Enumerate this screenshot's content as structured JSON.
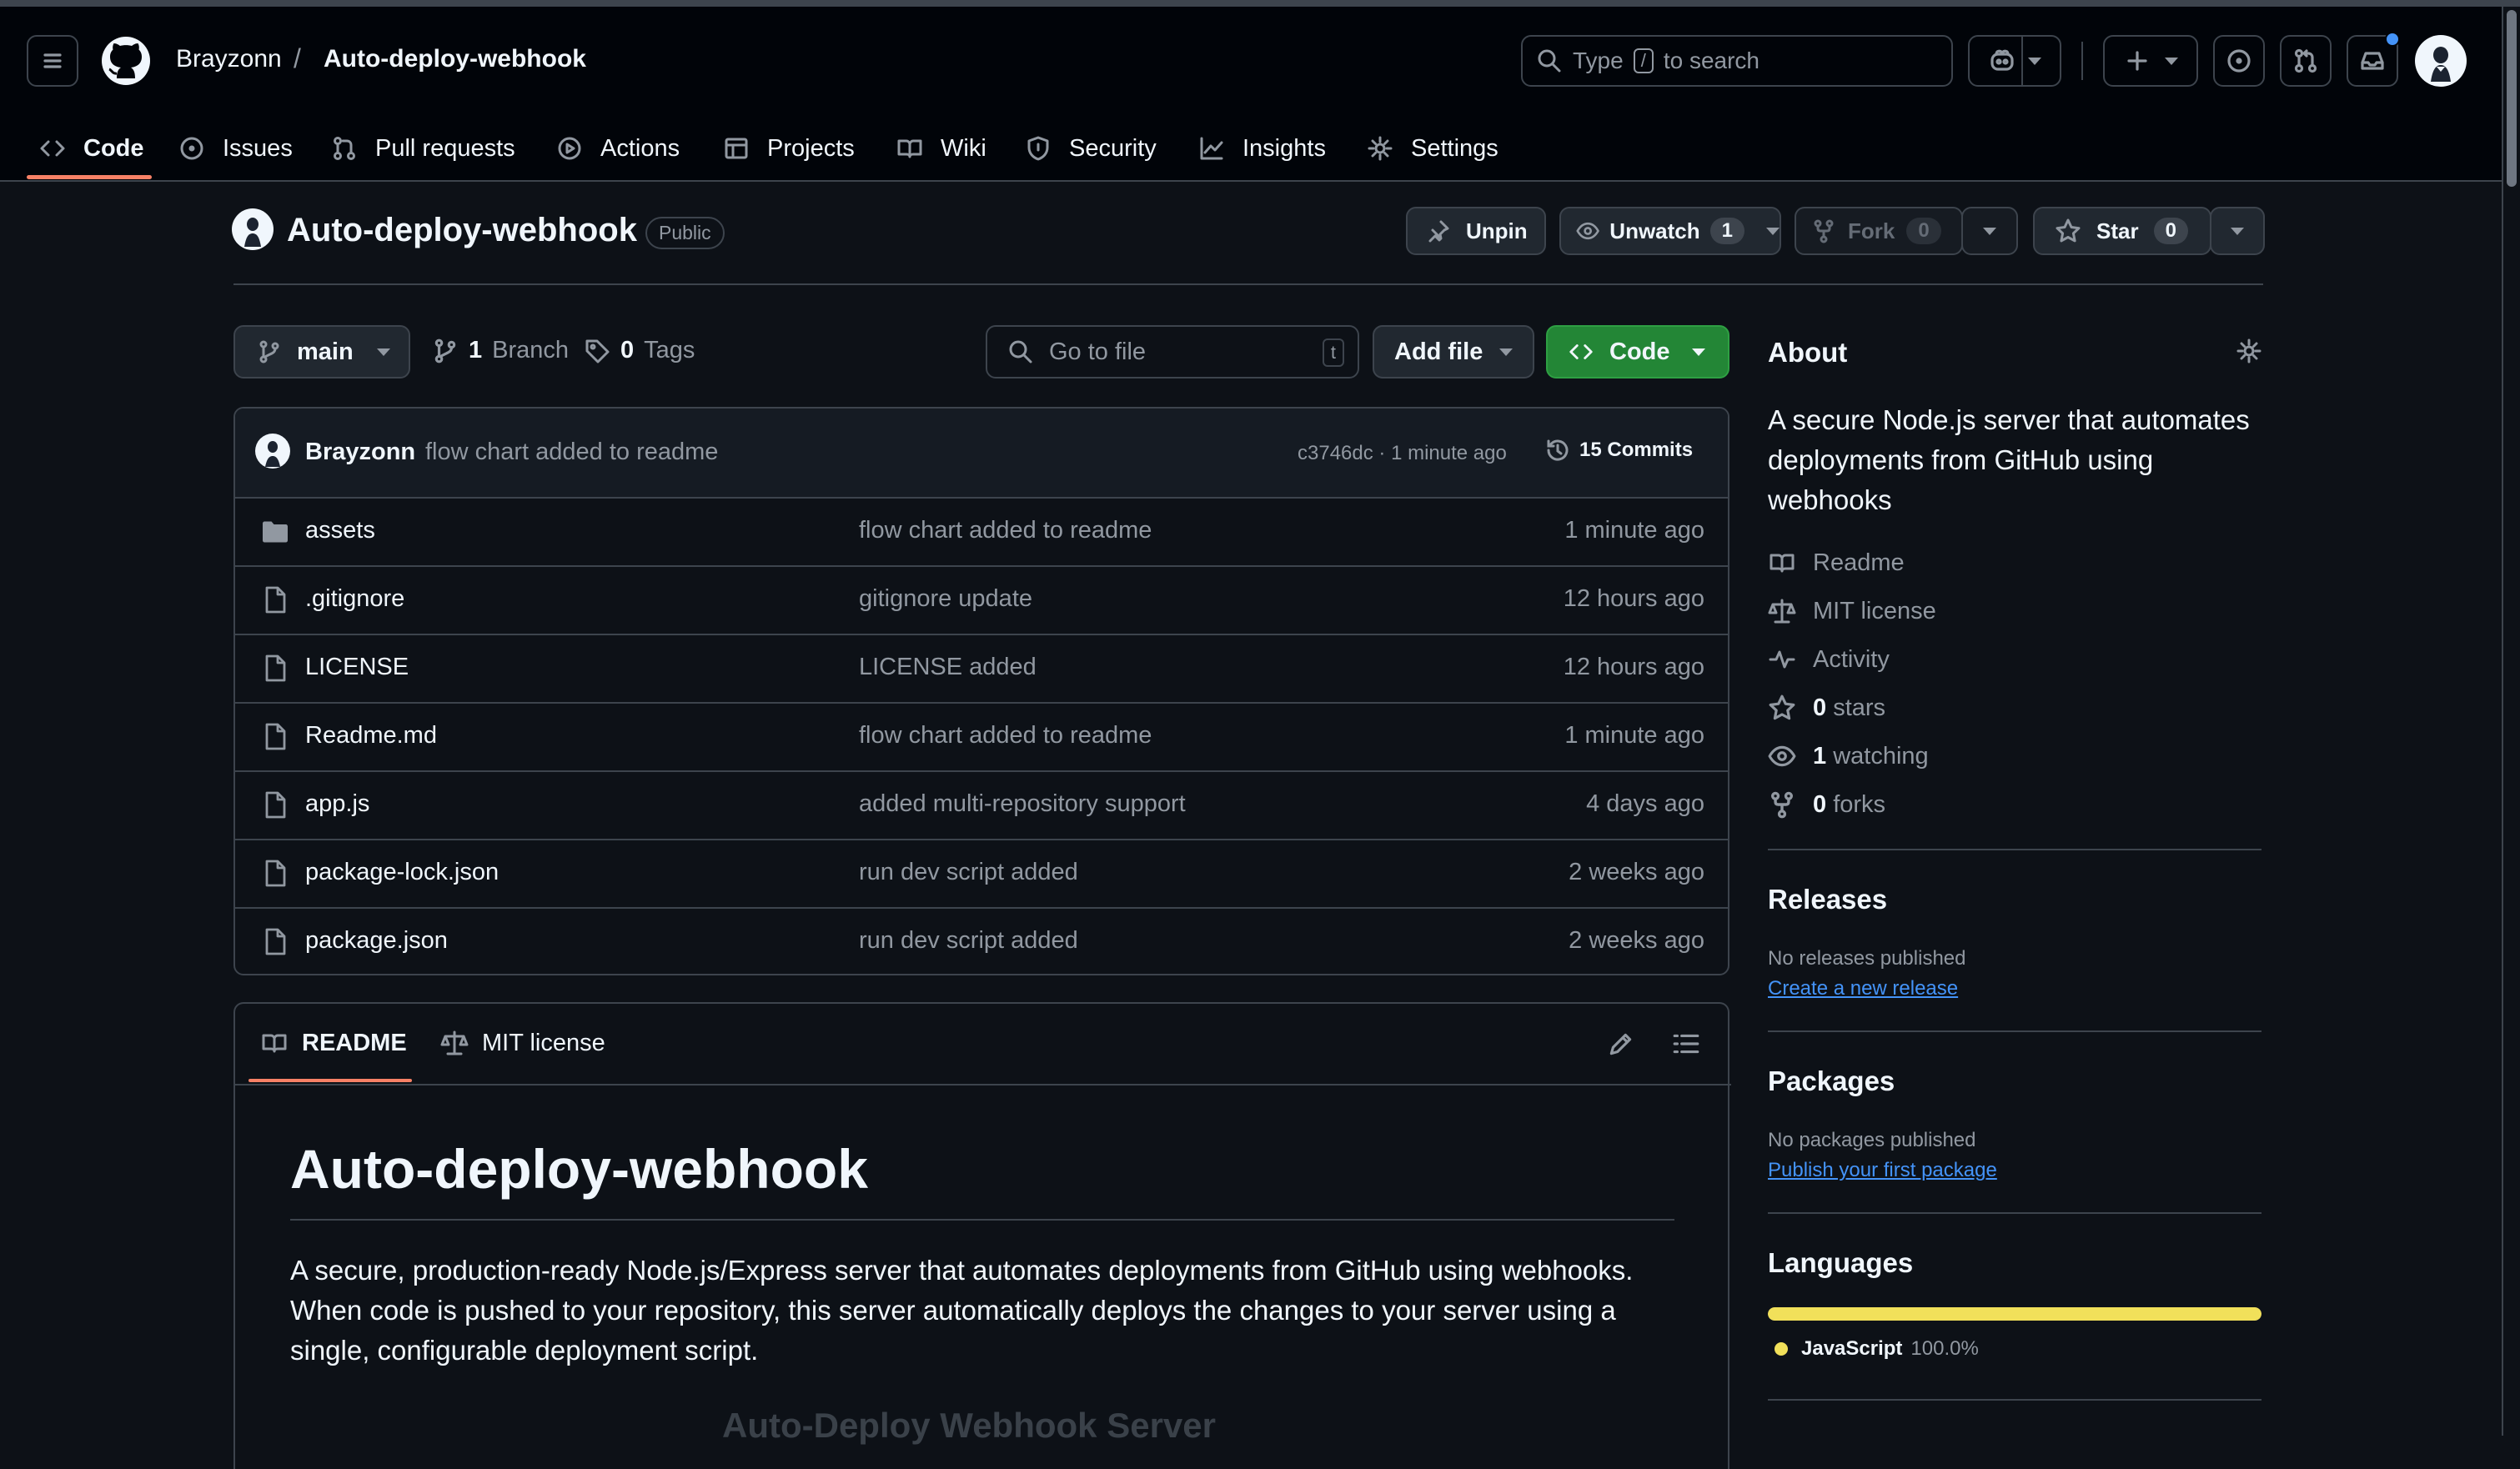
{
  "header": {
    "owner": "Brayzonn",
    "separator": "/",
    "repo": "Auto-deploy-webhook",
    "search_prefix": "Type",
    "search_key": "/",
    "search_suffix": "to search"
  },
  "nav": {
    "code": "Code",
    "issues": "Issues",
    "pulls": "Pull requests",
    "actions": "Actions",
    "projects": "Projects",
    "wiki": "Wiki",
    "security": "Security",
    "insights": "Insights",
    "settings": "Settings"
  },
  "repo_header": {
    "name": "Auto-deploy-webhook",
    "visibility": "Public",
    "unpin": "Unpin",
    "unwatch": "Unwatch",
    "watch_count": "1",
    "fork": "Fork",
    "fork_count": "0",
    "star": "Star",
    "star_count": "0"
  },
  "toolbar": {
    "branch": "main",
    "branch_count": "1",
    "branch_label": "Branch",
    "tag_count": "0",
    "tag_label": "Tags",
    "goto_placeholder": "Go to file",
    "goto_key": "t",
    "add_file": "Add file",
    "code_button": "Code"
  },
  "commit": {
    "author": "Brayzonn",
    "message": "flow chart added to readme",
    "hash_time": "c3746dc · 1 minute ago",
    "commits": "15 Commits"
  },
  "files": [
    {
      "name": "assets",
      "message": "flow chart added to readme",
      "time": "1 minute ago",
      "type": "folder"
    },
    {
      "name": ".gitignore",
      "message": "gitignore update",
      "time": "12 hours ago",
      "type": "file"
    },
    {
      "name": "LICENSE",
      "message": "LICENSE added",
      "time": "12 hours ago",
      "type": "file"
    },
    {
      "name": "Readme.md",
      "message": "flow chart added to readme",
      "time": "1 minute ago",
      "type": "file"
    },
    {
      "name": "app.js",
      "message": "added multi-repository support",
      "time": "4 days ago",
      "type": "file"
    },
    {
      "name": "package-lock.json",
      "message": "run dev script added",
      "time": "2 weeks ago",
      "type": "file"
    },
    {
      "name": "package.json",
      "message": "run dev script added",
      "time": "2 weeks ago",
      "type": "file"
    }
  ],
  "readme": {
    "tab_readme": "README",
    "tab_license": "MIT license",
    "title": "Auto-deploy-webhook",
    "intro_line1": "A secure, production-ready Node.js/Express server that automates deployments from GitHub using webhooks.",
    "intro_line2": "When code is pushed to your repository, this server automatically deploys the changes to your server using a",
    "intro_line3": "single, configurable deployment script.",
    "figure_title": "Auto-Deploy Webhook Server"
  },
  "about": {
    "title": "About",
    "desc_line1": "A secure Node.js server that automates",
    "desc_line2": "deployments from GitHub using",
    "desc_line3": "webhooks",
    "readme": "Readme",
    "license": "MIT license",
    "activity": "Activity",
    "stars_count": "0",
    "stars_label": "stars",
    "watching_count": "1",
    "watching_label": "watching",
    "forks_count": "0",
    "forks_label": "forks"
  },
  "releases": {
    "title": "Releases",
    "none": "No releases published",
    "link": "Create a new release"
  },
  "packages": {
    "title": "Packages",
    "none": "No packages published",
    "link": "Publish your first package"
  },
  "languages": {
    "title": "Languages",
    "items": [
      {
        "name": "JavaScript",
        "percent": "100.0%",
        "color": "#f1e05a",
        "share": 1.0
      }
    ]
  },
  "colors": {
    "accent_green": "#238636",
    "link_blue": "#4493f8",
    "nav_underline": "#f78166"
  }
}
